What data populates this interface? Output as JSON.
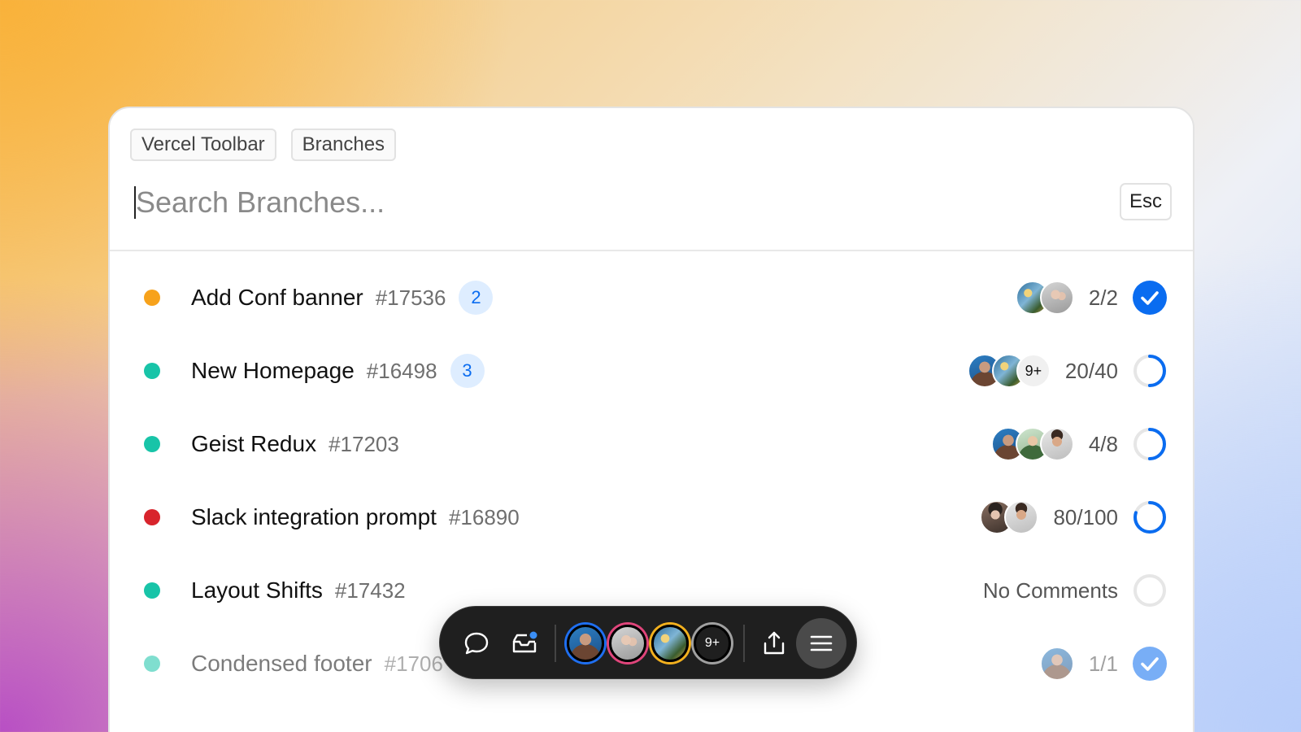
{
  "chips": [
    "Vercel Toolbar",
    "Branches"
  ],
  "search": {
    "placeholder": "Search Branches...",
    "esc_label": "Esc"
  },
  "colors": {
    "accent": "#0a6cf0",
    "yellow": "#f7a21b",
    "teal": "#18c4a8",
    "red": "#d8242c",
    "toolbar_bg": "#1f1f1f"
  },
  "rows": [
    {
      "title": "Add Conf banner",
      "pr": "#17536",
      "badge": "2",
      "dot": "yellow",
      "ratio": "2/2",
      "status": "complete",
      "progress": 1.0
    },
    {
      "title": "New Homepage",
      "pr": "#16498",
      "badge": "3",
      "dot": "teal",
      "ratio": "20/40",
      "more": "9+",
      "status": "progress",
      "progress": 0.5
    },
    {
      "title": "Geist Redux",
      "pr": "#17203",
      "dot": "teal",
      "ratio": "4/8",
      "status": "progress",
      "progress": 0.5
    },
    {
      "title": "Slack integration prompt",
      "pr": "#16890",
      "dot": "red",
      "ratio": "80/100",
      "status": "progress",
      "progress": 0.8
    },
    {
      "title": "Layout Shifts",
      "pr": "#17432",
      "dot": "teal",
      "ratio": "No Comments",
      "status": "empty",
      "progress": 0
    },
    {
      "title": "Condensed footer",
      "pr": "#1706",
      "dot": "teal",
      "ratio": "1/1",
      "status": "complete",
      "progress": 1.0
    }
  ],
  "toolbar": {
    "items": [
      "comment-icon",
      "inbox-icon",
      "avatar",
      "avatar",
      "avatar",
      "more-avatars",
      "share-icon",
      "menu-icon"
    ],
    "more_label": "9+"
  }
}
